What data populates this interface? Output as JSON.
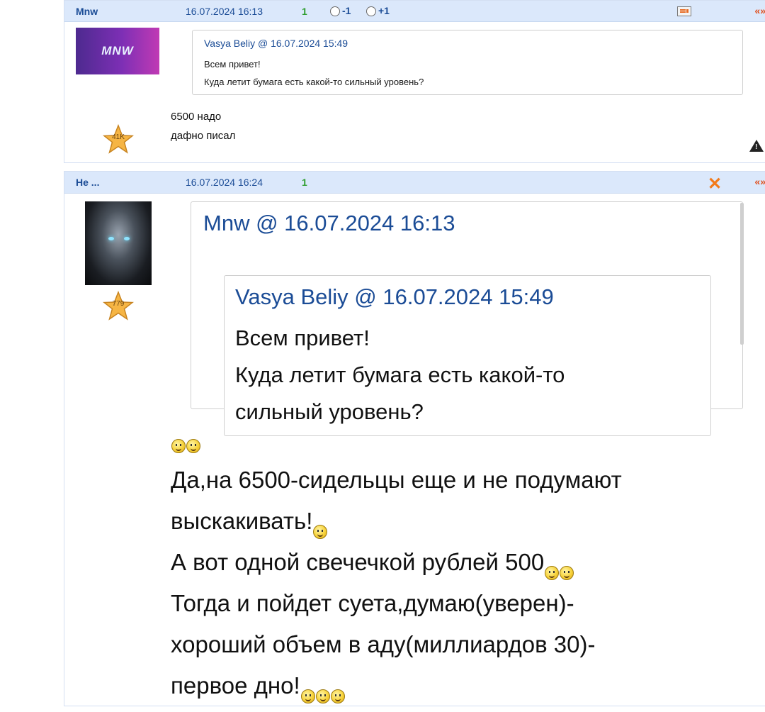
{
  "posts": [
    {
      "author": "Mnw",
      "date": "16.07.2024 16:13",
      "rating": "1",
      "vote_minus": "-1",
      "vote_plus": "+1",
      "quote_arrows": "«»",
      "rank": "41K",
      "avatar_text": "MNW",
      "quote": {
        "header": "Vasya Beliy @ 16.07.2024 15:49",
        "lines": [
          "Всем привет!",
          "Куда летит бумага есть какой-то сильный уровень?"
        ]
      },
      "text_lines": [
        "6500 надо",
        "дафно писал"
      ],
      "warning_icon": "!"
    },
    {
      "author": "Не ...",
      "date": "16.07.2024 16:24",
      "rating": "1",
      "quote_arrows": "«»",
      "close_icon": "✕",
      "rank": "779",
      "quote": {
        "header": "Mnw @ 16.07.2024 16:13",
        "inner_header": "Vasya Beliy @ 16.07.2024 15:49",
        "inner_lines": [
          "Всем привет!",
          "Куда летит бумага есть какой-то",
          "сильный уровень?"
        ]
      },
      "text_lines": [
        "Да,на 6500-сидельцы еще и не подумают",
        "выскакивать!",
        "А вот одной свечечкой рублей 500",
        "Тогда и пойдет суета,думаю(уверен)-",
        "хороший объем в аду(миллиардов 30)-",
        "первое дно!"
      ]
    }
  ],
  "colors": {
    "header_bg": "#dbe8fb",
    "link": "#1b4c96",
    "rating": "#2e9d2e",
    "accent": "#e0501e"
  }
}
